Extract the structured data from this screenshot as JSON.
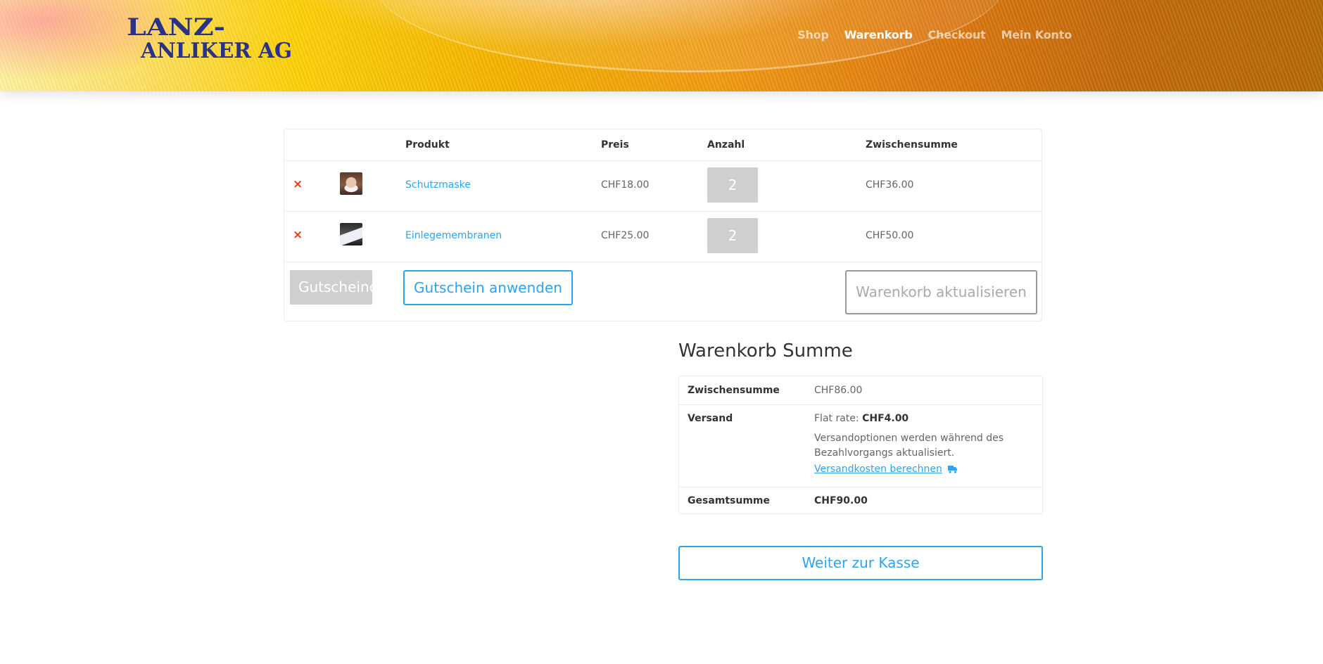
{
  "header": {
    "logo_text_line1": "LANZ-",
    "logo_text_line2": "ANLIKER AG",
    "nav": [
      {
        "label": "Shop",
        "active": false
      },
      {
        "label": "Warenkorb",
        "active": true
      },
      {
        "label": "Checkout",
        "active": false
      },
      {
        "label": "Mein Konto",
        "active": false
      }
    ]
  },
  "cart": {
    "columns": {
      "product": "Produkt",
      "price": "Preis",
      "quantity": "Anzahl",
      "subtotal": "Zwischensumme"
    },
    "items": [
      {
        "remove": "×",
        "name": "Schutzmaske",
        "price": "CHF18.00",
        "quantity": "2",
        "subtotal": "CHF36.00"
      },
      {
        "remove": "×",
        "name": "Einlegemembranen",
        "price": "CHF25.00",
        "quantity": "2",
        "subtotal": "CHF50.00"
      }
    ],
    "coupon_placeholder": "Gutscheincode",
    "coupon_button": "Gutschein anwenden",
    "update_button": "Warenkorb aktualisieren"
  },
  "totals": {
    "title": "Warenkorb Summe",
    "subtotal_label": "Zwischensumme",
    "subtotal_value": "CHF86.00",
    "shipping_label": "Versand",
    "shipping_rate_prefix": "Flat rate: ",
    "shipping_rate_value": "CHF4.00",
    "shipping_note": "Versandoptionen werden während des Bezahlvorgangs aktualisiert.",
    "shipping_calc_link": "Versandkosten berechnen",
    "total_label": "Gesamtsumme",
    "total_value": "CHF90.00",
    "checkout_button": "Weiter zur Kasse"
  },
  "colors": {
    "link": "#2ea3f2",
    "remove": "#e2401c",
    "logo": "#2a3189"
  },
  "icons": {
    "remove": "close-icon",
    "shipping_calc": "truck-icon"
  }
}
